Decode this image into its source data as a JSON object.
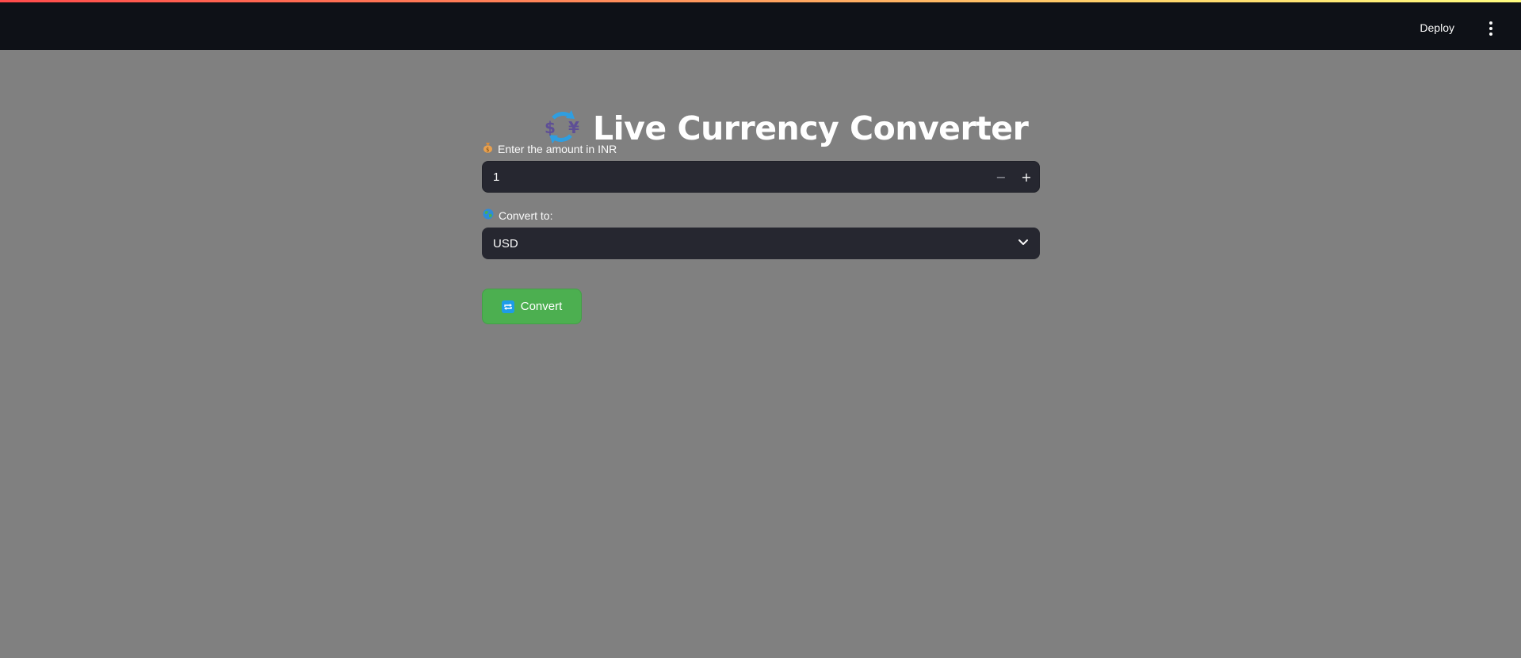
{
  "header": {
    "deploy_label": "Deploy",
    "menu_icon": "kebab-menu-icon"
  },
  "main": {
    "title_icon": "currency-exchange-icon",
    "title": "Live Currency Converter",
    "amount": {
      "label_icon": "money-bag-icon",
      "label": "Enter the amount in INR",
      "value": "1",
      "decrement": "−",
      "increment": "+"
    },
    "currency": {
      "label_icon": "globe-icon",
      "label": "Convert to:",
      "selected": "USD"
    },
    "convert_button": {
      "icon": "repeat-icon",
      "label": "Convert"
    }
  },
  "colors": {
    "header_bg": "#0e1117",
    "page_bg": "#808080",
    "input_bg": "#262730",
    "button_bg": "#4caf50"
  }
}
